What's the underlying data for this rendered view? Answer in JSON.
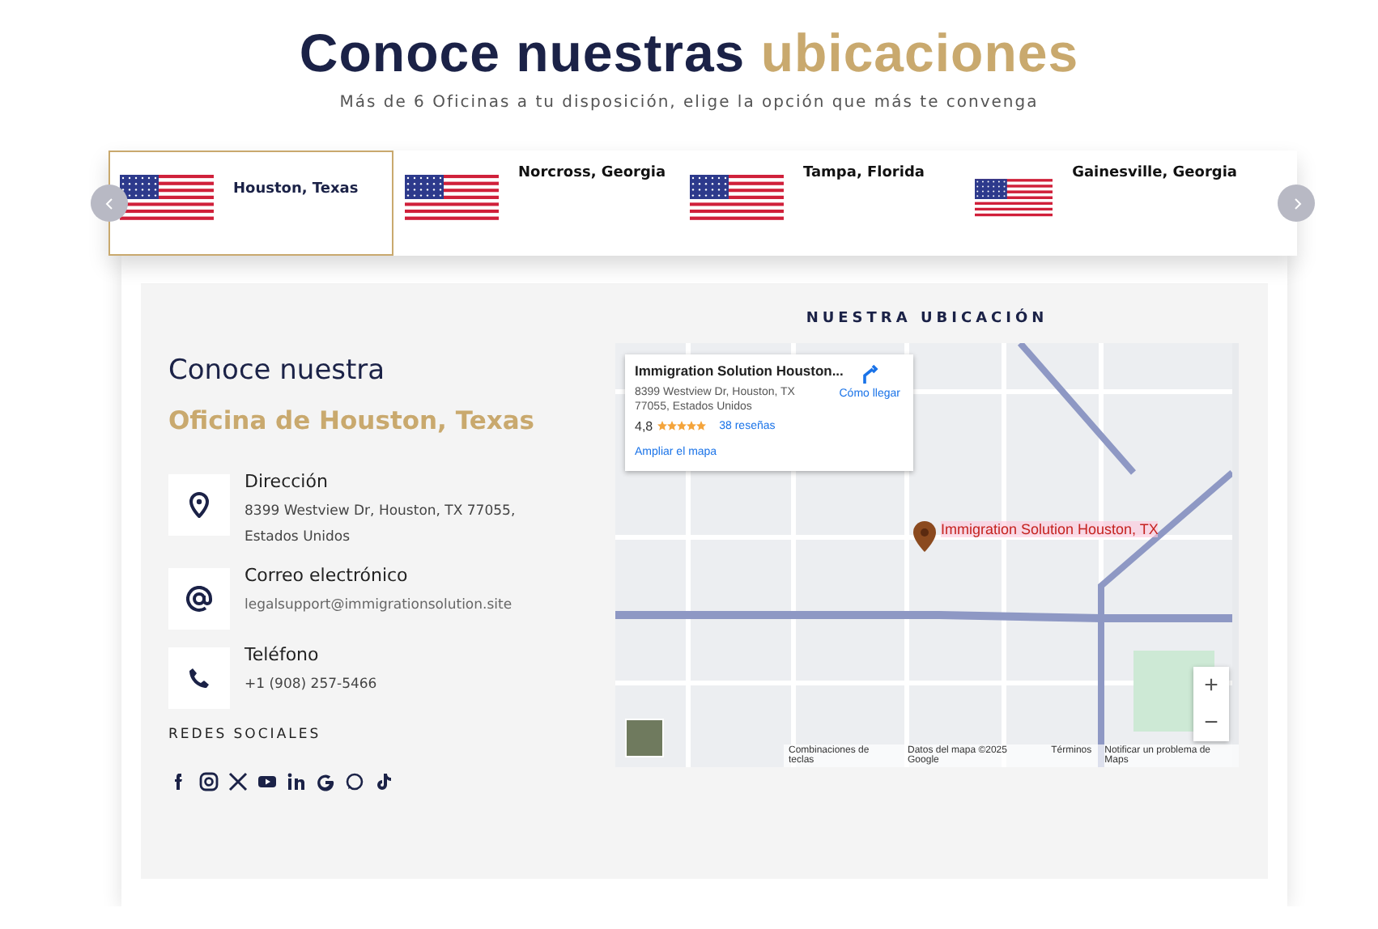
{
  "header": {
    "title": "Conoce nuestras",
    "title_highlight": "ubicaciones",
    "subtitle": "Más de 6 Oficinas a tu disposición, elige la opción que más te convenga"
  },
  "locations": [
    {
      "label": "Houston, Texas",
      "selected": true
    },
    {
      "label": "Norcross, Georgia",
      "selected": false
    },
    {
      "label": "Tampa, Florida",
      "selected": false
    },
    {
      "label": "Gainesville, Georgia",
      "selected": false
    }
  ],
  "office": {
    "heading": "Conoce nuestra",
    "name": "Oficina de Houston, Texas",
    "contacts": [
      {
        "kind": "address",
        "label": "Dirección",
        "value": "8399 Westview Dr, Houston, TX 77055, Estados Unidos"
      },
      {
        "kind": "email",
        "label": "Correo electrónico",
        "value": "legalsupport@immigrationsolution.site"
      },
      {
        "kind": "phone",
        "label": "Teléfono",
        "value": "+1 (908) 257-5466"
      }
    ],
    "social_label": "REDES SOCIALES"
  },
  "map": {
    "title": "NUESTRA UBICACIÓN",
    "card": {
      "name": "Immigration Solution Houston...",
      "address": "8399 Westview Dr, Houston, TX 77055, Estados Unidos",
      "rating": "4,8",
      "stars": 5,
      "reviews": "38 reseñas",
      "directions": "Cómo llegar",
      "enlarge": "Ampliar el mapa"
    },
    "pin_label": "Immigration Solution Houston, TX",
    "zoom_in": "+",
    "zoom_out": "−",
    "attribution": [
      "Combinaciones de teclas",
      "Datos del mapa ©2025 Google",
      "Términos",
      "Notificar un problema de Maps"
    ]
  }
}
